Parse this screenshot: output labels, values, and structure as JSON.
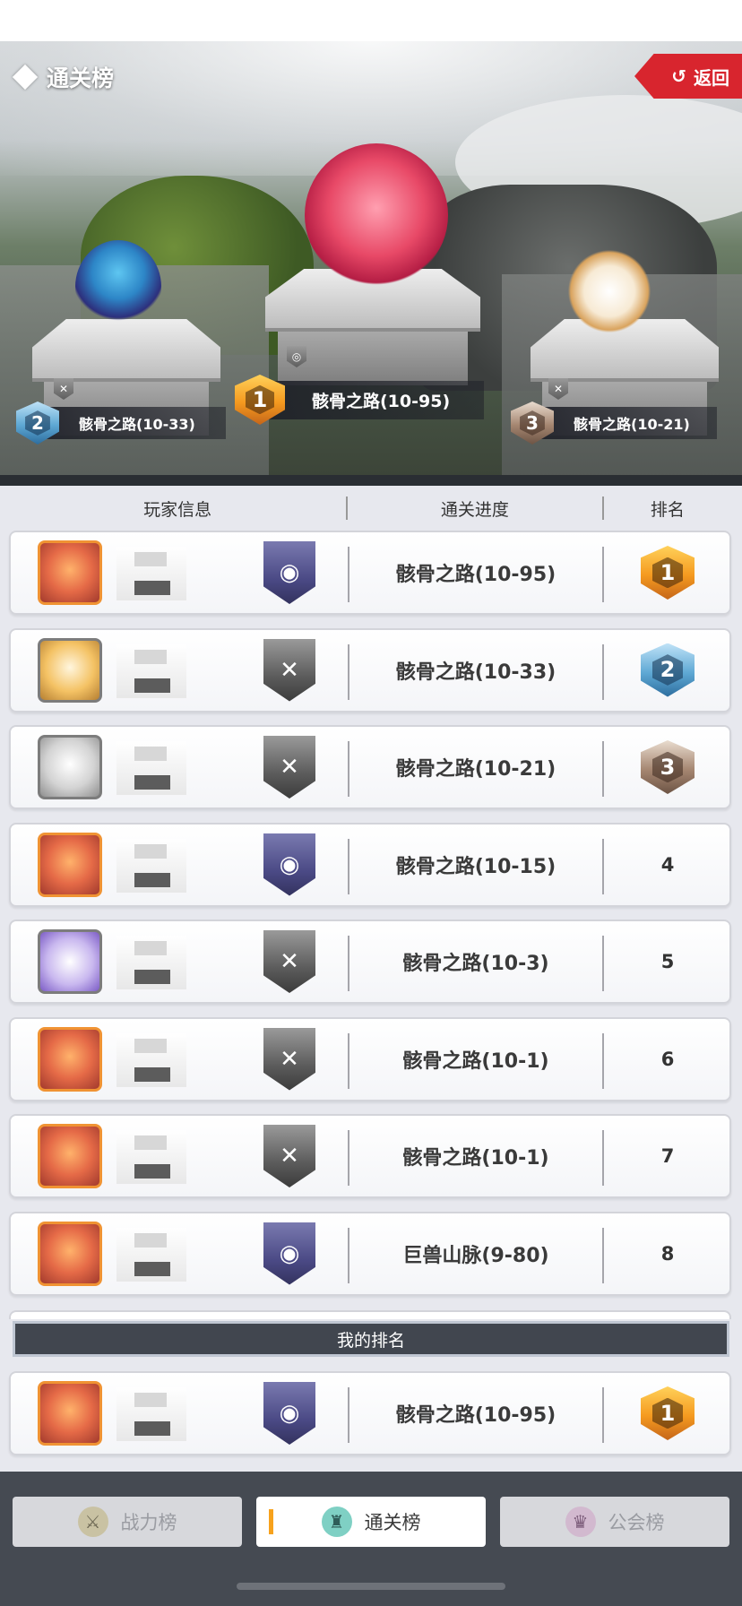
{
  "header": {
    "title": "通关榜",
    "back_label": "返回"
  },
  "podium": [
    {
      "rank": "1",
      "progress": "骸骨之路(10-95)"
    },
    {
      "rank": "2",
      "progress": "骸骨之路(10-33)"
    },
    {
      "rank": "3",
      "progress": "骸骨之路(10-21)"
    }
  ],
  "table": {
    "columns": [
      "玩家信息",
      "通关进度",
      "排名"
    ],
    "rows": [
      {
        "progress": "骸骨之路(10-95)",
        "rank": "1",
        "emblem": "purple"
      },
      {
        "progress": "骸骨之路(10-33)",
        "rank": "2",
        "emblem": "gray"
      },
      {
        "progress": "骸骨之路(10-21)",
        "rank": "3",
        "emblem": "gray"
      },
      {
        "progress": "骸骨之路(10-15)",
        "rank": "4",
        "emblem": "purple"
      },
      {
        "progress": "骸骨之路(10-3)",
        "rank": "5",
        "emblem": "gray"
      },
      {
        "progress": "骸骨之路(10-1)",
        "rank": "6",
        "emblem": "gray"
      },
      {
        "progress": "骸骨之路(10-1)",
        "rank": "7",
        "emblem": "gray"
      },
      {
        "progress": "巨兽山脉(9-80)",
        "rank": "8",
        "emblem": "purple"
      }
    ]
  },
  "my_rank": {
    "banner": "我的排名",
    "progress": "骸骨之路(10-95)",
    "rank": "1"
  },
  "tabs": [
    {
      "label": "战力榜",
      "icon": "sword-icon",
      "active": false
    },
    {
      "label": "通关榜",
      "icon": "castle-icon",
      "active": true
    },
    {
      "label": "公会榜",
      "icon": "guild-icon",
      "active": false
    }
  ],
  "colors": {
    "gold": "#f59a1f",
    "silver": "#5ea8d4",
    "bronze": "#a58671",
    "back_button": "#d8252e",
    "active_tab_bar": "#f7a21d"
  }
}
